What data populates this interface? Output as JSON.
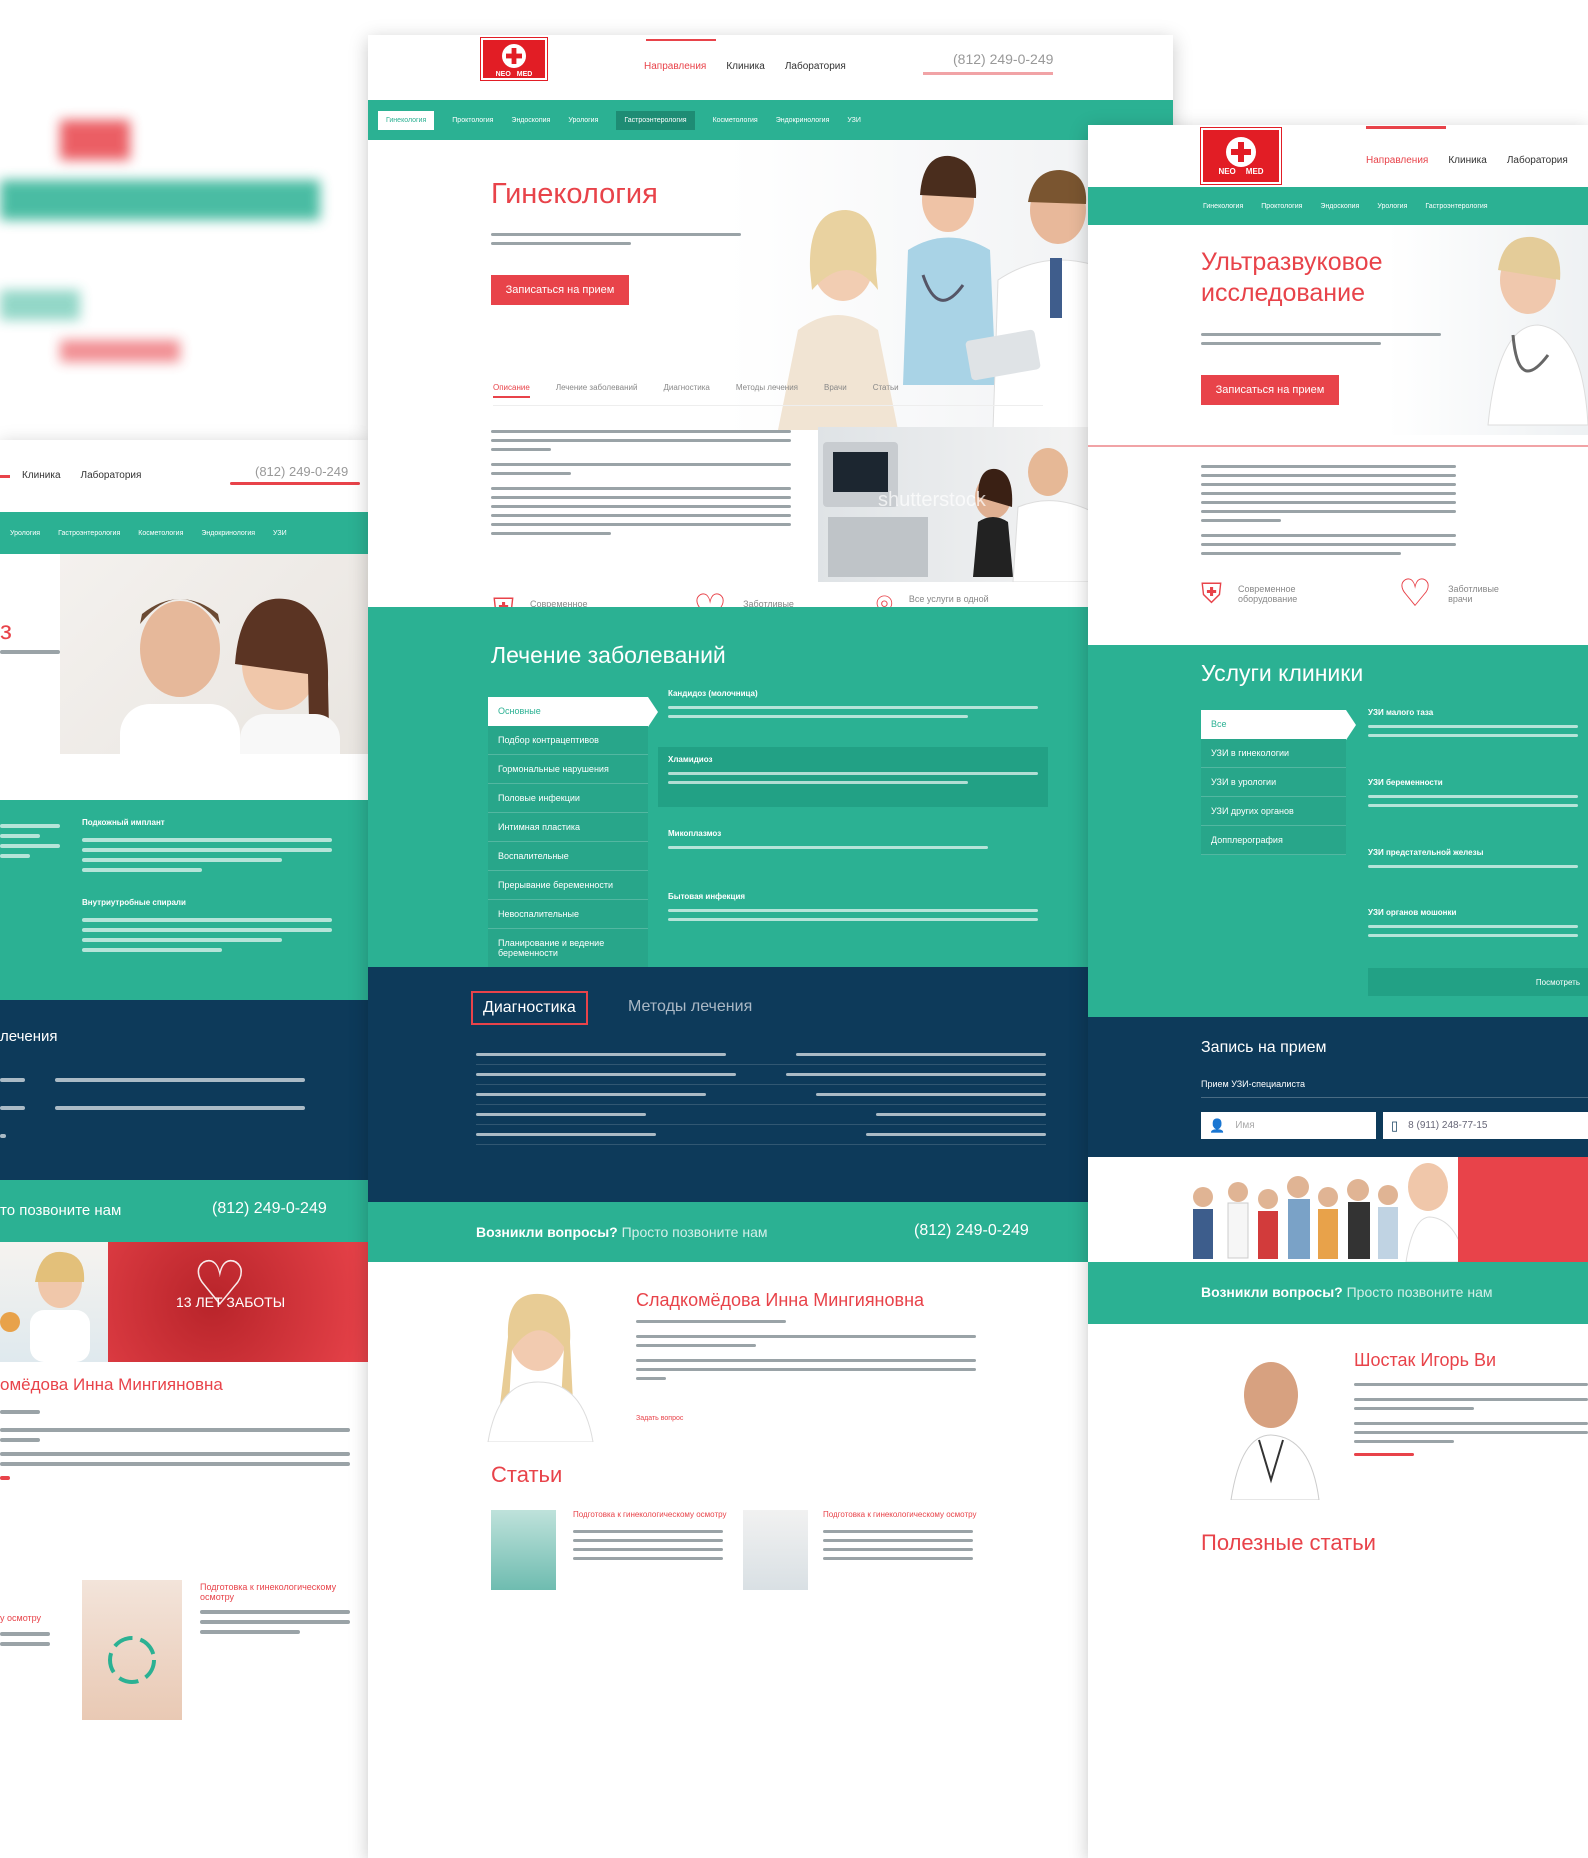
{
  "brand": {
    "logo_top": "NEO",
    "logo_bottom": "MED",
    "red": "#e8434a",
    "teal": "#2bb193",
    "navy": "#0d3a5a"
  },
  "left": {
    "nav": [
      "Клиника",
      "Лаборатория"
    ],
    "phone": "(812) 249-0-249",
    "subnav": [
      "Урология",
      "Гастроэнтерология",
      "Косметология",
      "Эндокринология",
      "УЗИ"
    ],
    "teal_items": [
      {
        "title": "Подкожный имплант"
      },
      {
        "title": "Внутриутробные спирали"
      }
    ],
    "navy_title": "лечения",
    "call_text": "то позвоните нам",
    "call_phone": "(812) 249-0-249",
    "banner": "13 ЛЕТ ЗАБОТЫ",
    "doctor": "омёдова Инна Мингияновна",
    "article_title": "Подготовка к гинекологическому осмотру",
    "article_link": "у осмотру"
  },
  "center": {
    "logo_top": "NEO",
    "logo_bottom": "MED",
    "nav": [
      {
        "label": "Направления",
        "active": true
      },
      {
        "label": "Клиника"
      },
      {
        "label": "Лаборатория"
      }
    ],
    "phone": "(812) 249-0-249",
    "subnav": [
      {
        "label": "Гинекология",
        "state": "sel"
      },
      {
        "label": "Проктология"
      },
      {
        "label": "Эндоскопия"
      },
      {
        "label": "Урология"
      },
      {
        "label": "Гастроэнтерология",
        "state": "hov"
      },
      {
        "label": "Косметология"
      },
      {
        "label": "Эндокринология"
      },
      {
        "label": "УЗИ"
      }
    ],
    "hero_title": "Гинекология",
    "hero_button": "Записаться на прием",
    "tabs": [
      {
        "label": "Описание",
        "active": true
      },
      {
        "label": "Лечение заболеваний"
      },
      {
        "label": "Диагностика"
      },
      {
        "label": "Методы лечения"
      },
      {
        "label": "Врачи"
      },
      {
        "label": "Статьи"
      }
    ],
    "watermark": "shutterstock",
    "features": [
      {
        "icon": "shield-icon",
        "glyph": "⛨",
        "label": "Современное оборудование"
      },
      {
        "icon": "heart-icon",
        "glyph": "♡",
        "label": "Заботливые врачи"
      },
      {
        "icon": "location-pin-icon",
        "glyph": "⌾",
        "label": "Все услуги в одной клинике"
      }
    ],
    "treat_title": "Лечение заболеваний",
    "treat_menu": [
      {
        "label": "Основные",
        "sel": true
      },
      {
        "label": "Подбор контрацептивов"
      },
      {
        "label": "Гормональные нарушения"
      },
      {
        "label": "Половые инфекции"
      },
      {
        "label": "Интимная пластика"
      },
      {
        "label": "Воспалительные"
      },
      {
        "label": "Прерывание беременности"
      },
      {
        "label": "Невоспалительные"
      },
      {
        "label": "Планирование и ведение беременности"
      }
    ],
    "treat_items": [
      {
        "title": "Кандидоз (молочница)"
      },
      {
        "title": "Хламидиоз"
      },
      {
        "title": "Микоплазмоз"
      },
      {
        "title": "Бытовая инфекция"
      }
    ],
    "diag_tabs": [
      {
        "label": "Диагностика",
        "active": true
      },
      {
        "label": "Методы лечения"
      }
    ],
    "call_strong": "Возникли вопросы?",
    "call_light": "Просто позвоните нам",
    "call_phone": "(812) 249-0-249",
    "doctor_name": "Сладкомёдова Инна Мингияновна",
    "doctor_link": "Задать вопрос",
    "articles_title": "Статьи",
    "articles": [
      {
        "title": "Подготовка к гинекологическому осмотру"
      },
      {
        "title": "Подготовка к гинекологическому осмотру"
      }
    ]
  },
  "right": {
    "logo_top": "NEO",
    "logo_bottom": "MED",
    "nav": [
      {
        "label": "Направления",
        "active": true
      },
      {
        "label": "Клиника"
      },
      {
        "label": "Лаборатория"
      }
    ],
    "subnav": [
      "Гинекология",
      "Проктология",
      "Эндоскопия",
      "Урология",
      "Гастроэнтерология"
    ],
    "hero_title_1": "Ультразвуковое",
    "hero_title_2": "исследование",
    "hero_button": "Записаться на прием",
    "features": [
      {
        "icon": "shield-icon",
        "glyph": "⛨",
        "label": "Современное оборудование"
      },
      {
        "icon": "heart-icon",
        "glyph": "♡",
        "label": "Заботливые врачи"
      }
    ],
    "services_title": "Услуги клиники",
    "services_menu": [
      {
        "label": "Все",
        "sel": true
      },
      {
        "label": "УЗИ в гинекологии"
      },
      {
        "label": "УЗИ в урологии"
      },
      {
        "label": "УЗИ других органов"
      },
      {
        "label": "Допплерография"
      }
    ],
    "services_items": [
      {
        "title": "УЗИ малого таза"
      },
      {
        "title": "УЗИ беременности"
      },
      {
        "title": "УЗИ предстательной железы"
      },
      {
        "title": "УЗИ органов мошонки"
      }
    ],
    "more_link": "Посмотреть",
    "booking_title": "Запись на прием",
    "booking_sub": "Прием УЗИ-специалиста",
    "name_placeholder": "Имя",
    "phone_placeholder": "8 (911) 248-77-15",
    "call_strong": "Возникли вопросы?",
    "call_light": "Просто позвоните нам",
    "doctor_name": "Шостак Игорь Ви",
    "articles_title": "Полезные статьи"
  }
}
